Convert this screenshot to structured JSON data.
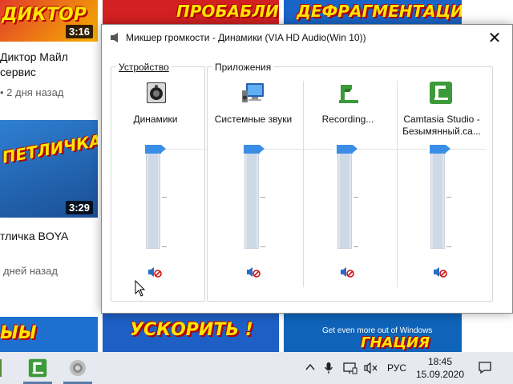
{
  "background": {
    "videos": [
      {
        "overlay": "ДИКТОР",
        "duration": "3:16",
        "title": "Диктор Майл",
        "title2": "сервис",
        "meta": "• 2 дня назад"
      },
      {
        "overlay": "ПЕТЛИЧКА",
        "duration": "3:29",
        "title": "тличка BOYA",
        "meta": "дней назад"
      }
    ],
    "top_thumbs": [
      "ПРОБАБЛИ",
      "ДЕФРАГМЕНТАЦИЯ"
    ],
    "bottom_thumbs": [
      "ЫЫ",
      "УСКОРИТЬ !",
      "Get even more out of Windows",
      "ГНАЦИЯ"
    ]
  },
  "mixer": {
    "title": "Микшер громкости - Динамики (VIA HD Audio(Win 10))",
    "close_glyph": "✕",
    "device_group_label": "Устройство",
    "apps_group_label": "Приложения",
    "channels": [
      {
        "name": "Динамики",
        "name2": "",
        "icon": "speaker-icon",
        "level_percent": 100,
        "muted": true
      },
      {
        "name": "Системные звуки",
        "name2": "",
        "icon": "system-sounds-icon",
        "level_percent": 100,
        "muted": true
      },
      {
        "name": "Recording...",
        "name2": "",
        "icon": "camtasia-recorder-icon",
        "level_percent": 100,
        "muted": true
      },
      {
        "name": "Camtasia Studio -",
        "name2": "Безымянный.ca...",
        "icon": "camtasia-studio-icon",
        "level_percent": 100,
        "muted": true
      }
    ]
  },
  "taskbar": {
    "lang": "РУС",
    "time": "18:45",
    "date": "15.09.2020",
    "tray_icons": [
      "chevron-up-icon",
      "microphone-icon",
      "network-icon",
      "volume-muted-icon",
      "notification-icon"
    ]
  },
  "colors": {
    "slider_thumb": "#3b8ee6",
    "camtasia_green": "#3d9a3a",
    "taskbar_bg": "#e6e9ef"
  }
}
